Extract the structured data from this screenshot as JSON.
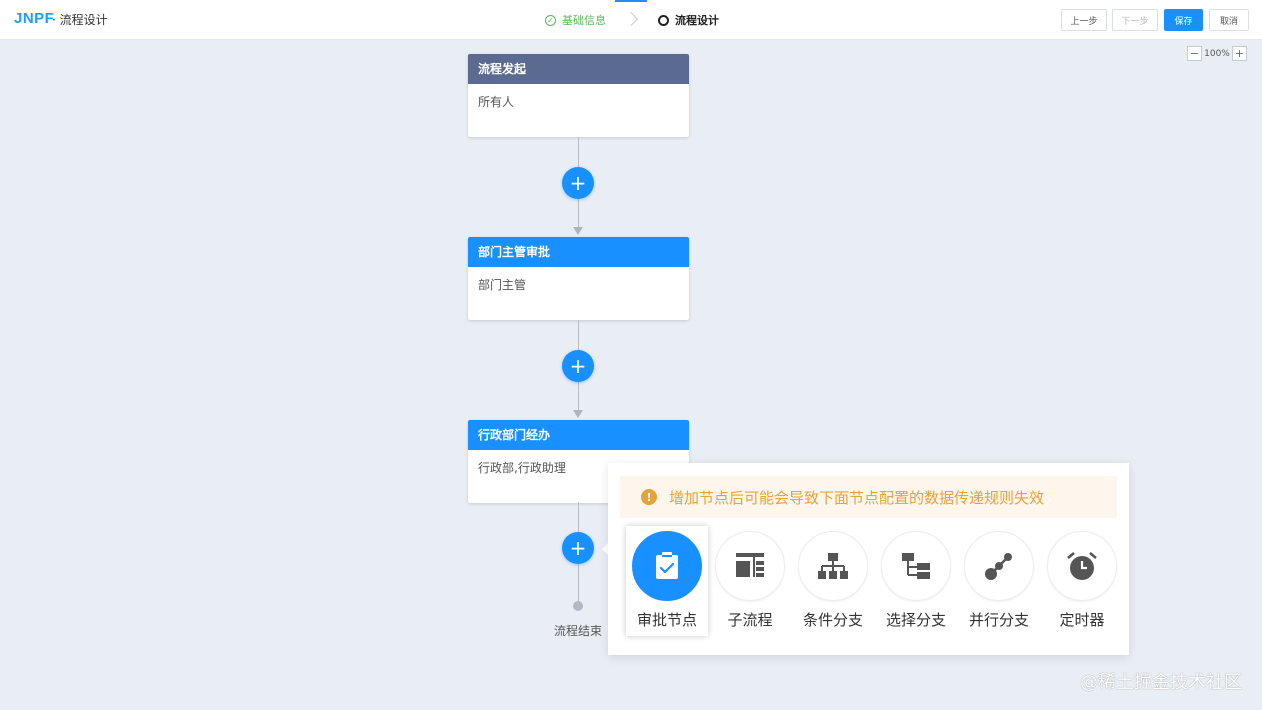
{
  "header": {
    "logo_part1": "JNPF",
    "app_title": "· 流程设计",
    "steps": [
      {
        "label": "基础信息",
        "state": "done"
      },
      {
        "label": "流程设计",
        "state": "active"
      }
    ],
    "buttons": {
      "prev": "上一步",
      "next": "下一步",
      "save": "保存",
      "cancel": "取消"
    }
  },
  "zoom": {
    "minus": "−",
    "value": "100%",
    "plus": "+"
  },
  "flow": {
    "nodes": [
      {
        "title": "流程发起",
        "content": "所有人",
        "color": "#5a6a90"
      },
      {
        "title": "部门主管审批",
        "content": "部门主管",
        "color": "#1890ff"
      },
      {
        "title": "行政部门经办",
        "content": "行政部,行政助理",
        "color": "#1890ff"
      }
    ],
    "add_symbol": "+",
    "end_label": "流程结束"
  },
  "popover": {
    "warning": "增加节点后可能会导致下面节点配置的数据传递规则失效",
    "warning_icon": "!",
    "options": [
      {
        "label": "审批节点",
        "icon": "clipboard-check-icon",
        "selected": true
      },
      {
        "label": "子流程",
        "icon": "subprocess-icon",
        "selected": false
      },
      {
        "label": "条件分支",
        "icon": "org-tree-icon",
        "selected": false
      },
      {
        "label": "选择分支",
        "icon": "select-branch-icon",
        "selected": false
      },
      {
        "label": "并行分支",
        "icon": "parallel-branch-icon",
        "selected": false
      },
      {
        "label": "定时器",
        "icon": "alarm-clock-icon",
        "selected": false
      }
    ]
  },
  "watermark": "@稀土掘金技术社区",
  "colors": {
    "accent": "#1890ff",
    "start_header": "#5a6a90",
    "warning": "#e6a23c",
    "success": "#5cb85c"
  }
}
